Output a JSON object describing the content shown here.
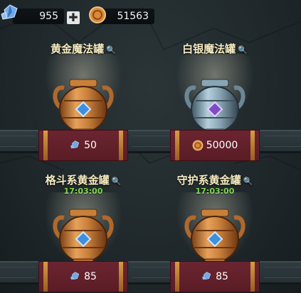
{
  "resources": {
    "gems": "955",
    "coins": "51563"
  },
  "jars": [
    {
      "title": "黄金魔法罐",
      "timer": "",
      "cost": "50",
      "cost_icon": "gem-icon",
      "jar": "gold"
    },
    {
      "title": "白银魔法罐",
      "timer": "",
      "cost": "50000",
      "cost_icon": "coin-icon",
      "jar": "silver"
    },
    {
      "title": "格斗系黄金罐",
      "timer": "17:03:00",
      "cost": "85",
      "cost_icon": "gem-icon",
      "jar": "gold"
    },
    {
      "title": "守护系黄金罐",
      "timer": "17:03:00",
      "cost": "85",
      "cost_icon": "gem-icon",
      "jar": "gold"
    }
  ],
  "colors": {
    "title": "#f7edc2",
    "timer": "#7dd84a",
    "plaque": "#6b2530",
    "gold": "#c8803a",
    "silver": "#8aa6b5"
  }
}
